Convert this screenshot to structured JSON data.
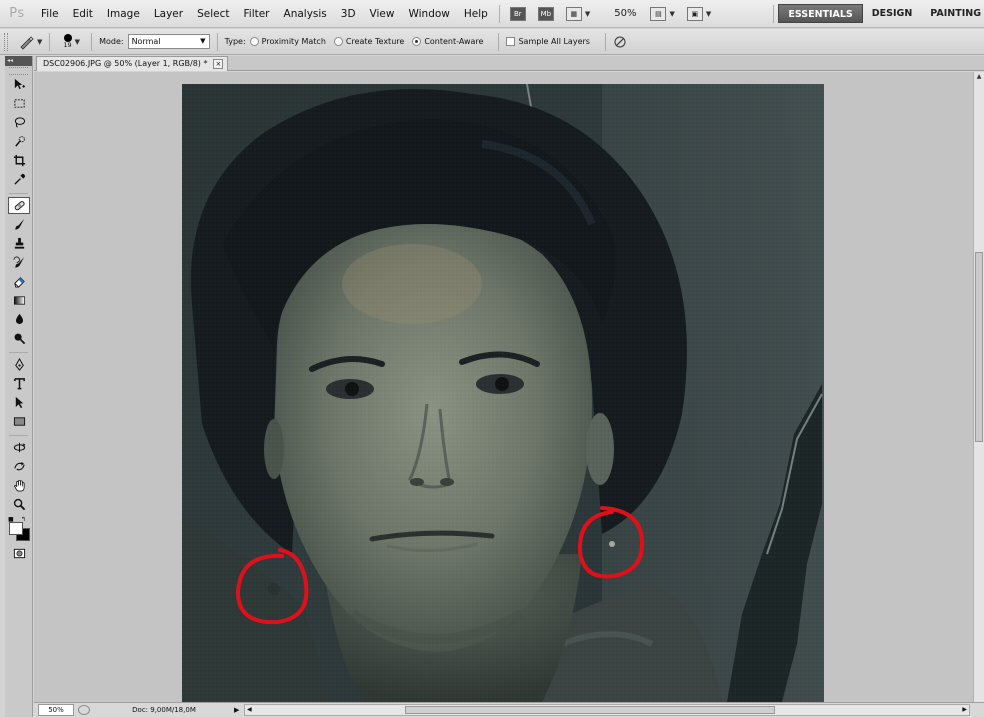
{
  "app": {
    "logo": "Ps"
  },
  "menu": {
    "items": [
      "File",
      "Edit",
      "Image",
      "Layer",
      "Select",
      "Filter",
      "Analysis",
      "3D",
      "View",
      "Window",
      "Help"
    ]
  },
  "menubar_tools": {
    "zoom_level": "50%",
    "br_label": "Br",
    "mb_label": "Mb"
  },
  "workspaces": {
    "items": [
      "ESSENTIALS",
      "DESIGN",
      "PAINTING"
    ],
    "active": "ESSENTIALS"
  },
  "options": {
    "brush_size": "19",
    "mode_label": "Mode:",
    "mode_value": "Normal",
    "type_label": "Type:",
    "type_options": [
      "Proximity Match",
      "Create Texture",
      "Content-Aware"
    ],
    "type_selected": "Content-Aware",
    "sample_all_layers": "Sample All Layers"
  },
  "toolbox": {
    "header": "◂◂"
  },
  "document": {
    "tab_title": "DSC02906.JPG @ 50% (Layer 1, RGB/8) *",
    "close_glyph": "×"
  },
  "status": {
    "zoom": "50%",
    "doc_size": "Doc: 9,00M/18,0M"
  },
  "colors": {
    "annotation_red": "#e0101a",
    "active_workspace_bg": "#5a5a5a",
    "canvas_bg": "#c4c4c4"
  }
}
